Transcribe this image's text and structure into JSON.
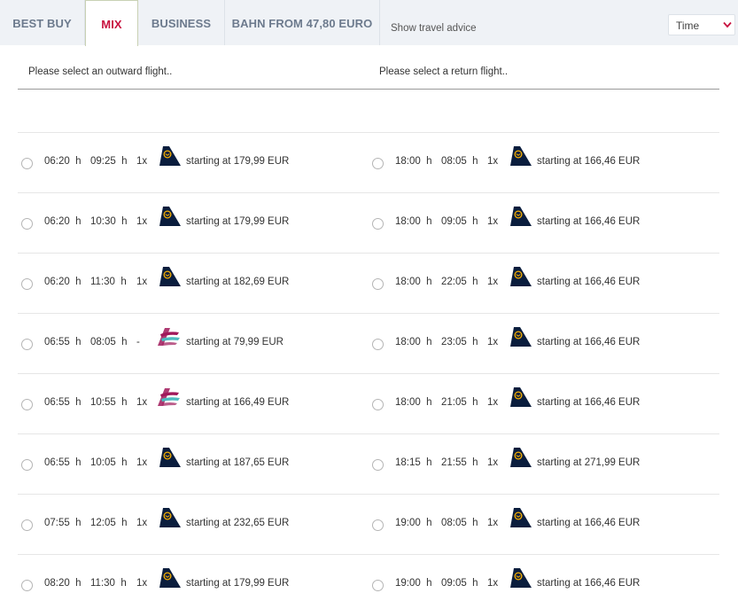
{
  "tabs": [
    {
      "label": "BEST BUY",
      "active": false
    },
    {
      "label": "MIX",
      "active": true
    },
    {
      "label": "BUSINESS",
      "active": false
    },
    {
      "label": "BAHN FROM 47,80 EURO",
      "active": false
    }
  ],
  "travel_advice": "Show travel advice",
  "sort": {
    "selected": "Time"
  },
  "outward": {
    "heading": "Please select an outward flight..",
    "flights": [
      {
        "dep": "06:20",
        "arr": "09:25",
        "stops": "1x",
        "airline": "lufthansa",
        "price": "starting at 179,99 EUR"
      },
      {
        "dep": "06:20",
        "arr": "10:30",
        "stops": "1x",
        "airline": "lufthansa",
        "price": "starting at 179,99 EUR"
      },
      {
        "dep": "06:20",
        "arr": "11:30",
        "stops": "1x",
        "airline": "lufthansa",
        "price": "starting at 182,69 EUR"
      },
      {
        "dep": "06:55",
        "arr": "08:05",
        "stops": "-",
        "airline": "eurowings",
        "price": "starting at 79,99 EUR"
      },
      {
        "dep": "06:55",
        "arr": "10:55",
        "stops": "1x",
        "airline": "eurowings",
        "price": "starting at 166,49 EUR"
      },
      {
        "dep": "06:55",
        "arr": "10:05",
        "stops": "1x",
        "airline": "lufthansa",
        "price": "starting at 187,65 EUR"
      },
      {
        "dep": "07:55",
        "arr": "12:05",
        "stops": "1x",
        "airline": "lufthansa",
        "price": "starting at 232,65 EUR"
      },
      {
        "dep": "08:20",
        "arr": "11:30",
        "stops": "1x",
        "airline": "lufthansa",
        "price": "starting at 179,99 EUR"
      }
    ]
  },
  "return": {
    "heading": "Please select a return flight..",
    "flights": [
      {
        "dep": "18:00",
        "arr": "08:05",
        "stops": "1x",
        "airline": "lufthansa",
        "price": "starting at 166,46 EUR"
      },
      {
        "dep": "18:00",
        "arr": "09:05",
        "stops": "1x",
        "airline": "lufthansa",
        "price": "starting at 166,46 EUR"
      },
      {
        "dep": "18:00",
        "arr": "22:05",
        "stops": "1x",
        "airline": "lufthansa",
        "price": "starting at 166,46 EUR"
      },
      {
        "dep": "18:00",
        "arr": "23:05",
        "stops": "1x",
        "airline": "lufthansa",
        "price": "starting at 166,46 EUR"
      },
      {
        "dep": "18:00",
        "arr": "21:05",
        "stops": "1x",
        "airline": "lufthansa",
        "price": "starting at 166,46 EUR"
      },
      {
        "dep": "18:15",
        "arr": "21:55",
        "stops": "1x",
        "airline": "lufthansa",
        "price": "starting at 271,99 EUR"
      },
      {
        "dep": "19:00",
        "arr": "08:05",
        "stops": "1x",
        "airline": "lufthansa",
        "price": "starting at 166,46 EUR"
      },
      {
        "dep": "19:00",
        "arr": "09:05",
        "stops": "1x",
        "airline": "lufthansa",
        "price": "starting at 166,46 EUR"
      }
    ]
  },
  "hour_unit": "h",
  "colors": {
    "accent": "#c8123f",
    "lufthansa_navy": "#0a1d3d",
    "lufthansa_yellow": "#f9b000",
    "eurowings_magenta": "#a0195a",
    "eurowings_teal": "#4cbcc0"
  }
}
